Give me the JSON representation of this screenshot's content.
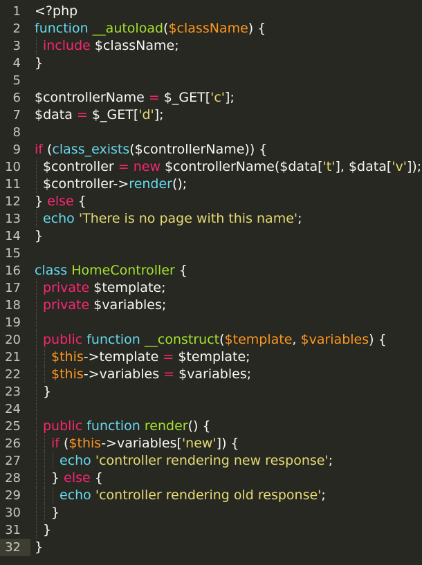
{
  "editor": {
    "theme_colors": {
      "background": "#272822",
      "plain": "#f8f8f2",
      "keyword": "#f92672",
      "storage": "#66d9ef",
      "function": "#a6e22e",
      "parameter": "#fd971f",
      "string": "#e6db74"
    },
    "active_line": 32,
    "lines": [
      {
        "n": "1",
        "indent": 0,
        "tokens": [
          [
            "plain",
            "<?php"
          ]
        ]
      },
      {
        "n": "2",
        "indent": 0,
        "tokens": [
          [
            "storage",
            "function"
          ],
          [
            "plain",
            " "
          ],
          [
            "func",
            "__autoload"
          ],
          [
            "plain",
            "("
          ],
          [
            "param",
            "$className"
          ],
          [
            "plain",
            ") {"
          ]
        ]
      },
      {
        "n": "3",
        "indent": 1,
        "tokens": [
          [
            "kw",
            "include"
          ],
          [
            "plain",
            " $className;"
          ]
        ]
      },
      {
        "n": "4",
        "indent": 0,
        "tokens": [
          [
            "plain",
            "}"
          ]
        ]
      },
      {
        "n": "5",
        "indent": 0,
        "tokens": []
      },
      {
        "n": "6",
        "indent": 0,
        "tokens": [
          [
            "plain",
            "$controllerName "
          ],
          [
            "kw",
            "="
          ],
          [
            "plain",
            " $_GET["
          ],
          [
            "string",
            "'c'"
          ],
          [
            "plain",
            "];"
          ]
        ]
      },
      {
        "n": "7",
        "indent": 0,
        "tokens": [
          [
            "plain",
            "$data "
          ],
          [
            "kw",
            "="
          ],
          [
            "plain",
            " $_GET["
          ],
          [
            "string",
            "'d'"
          ],
          [
            "plain",
            "];"
          ]
        ]
      },
      {
        "n": "8",
        "indent": 0,
        "tokens": []
      },
      {
        "n": "9",
        "indent": 0,
        "tokens": [
          [
            "kw",
            "if"
          ],
          [
            "plain",
            " ("
          ],
          [
            "builtin",
            "class_exists"
          ],
          [
            "plain",
            "($controllerName)) {"
          ]
        ]
      },
      {
        "n": "10",
        "indent": 1,
        "tokens": [
          [
            "plain",
            "$controller "
          ],
          [
            "kw",
            "="
          ],
          [
            "plain",
            " "
          ],
          [
            "kw",
            "new"
          ],
          [
            "plain",
            " $controllerName($data["
          ],
          [
            "string",
            "'t'"
          ],
          [
            "plain",
            "], $data["
          ],
          [
            "string",
            "'v'"
          ],
          [
            "plain",
            "]);"
          ]
        ]
      },
      {
        "n": "11",
        "indent": 1,
        "tokens": [
          [
            "plain",
            "$controller->"
          ],
          [
            "builtin",
            "render"
          ],
          [
            "plain",
            "();"
          ]
        ]
      },
      {
        "n": "12",
        "indent": 0,
        "tokens": [
          [
            "plain",
            "} "
          ],
          [
            "kw",
            "else"
          ],
          [
            "plain",
            " {"
          ]
        ]
      },
      {
        "n": "13",
        "indent": 1,
        "tokens": [
          [
            "builtin",
            "echo"
          ],
          [
            "plain",
            " "
          ],
          [
            "string",
            "'There is no page with this name'"
          ],
          [
            "plain",
            ";"
          ]
        ]
      },
      {
        "n": "14",
        "indent": 0,
        "tokens": [
          [
            "plain",
            "}"
          ]
        ]
      },
      {
        "n": "15",
        "indent": 0,
        "tokens": []
      },
      {
        "n": "16",
        "indent": 0,
        "tokens": [
          [
            "storage",
            "class"
          ],
          [
            "plain",
            " "
          ],
          [
            "func",
            "HomeController"
          ],
          [
            "plain",
            " {"
          ]
        ]
      },
      {
        "n": "17",
        "indent": 1,
        "tokens": [
          [
            "kw",
            "private"
          ],
          [
            "plain",
            " $template;"
          ]
        ]
      },
      {
        "n": "18",
        "indent": 1,
        "tokens": [
          [
            "kw",
            "private"
          ],
          [
            "plain",
            " $variables;"
          ]
        ]
      },
      {
        "n": "19",
        "indent": 1,
        "tokens": []
      },
      {
        "n": "20",
        "indent": 1,
        "tokens": [
          [
            "kw",
            "public"
          ],
          [
            "plain",
            " "
          ],
          [
            "storage",
            "function"
          ],
          [
            "plain",
            " "
          ],
          [
            "func",
            "__construct"
          ],
          [
            "plain",
            "("
          ],
          [
            "param",
            "$template"
          ],
          [
            "plain",
            ", "
          ],
          [
            "param",
            "$variables"
          ],
          [
            "plain",
            ") {"
          ]
        ]
      },
      {
        "n": "21",
        "indent": 2,
        "tokens": [
          [
            "param",
            "$this"
          ],
          [
            "plain",
            "->template "
          ],
          [
            "kw",
            "="
          ],
          [
            "plain",
            " $template;"
          ]
        ]
      },
      {
        "n": "22",
        "indent": 2,
        "tokens": [
          [
            "param",
            "$this"
          ],
          [
            "plain",
            "->variables "
          ],
          [
            "kw",
            "="
          ],
          [
            "plain",
            " $variables;"
          ]
        ]
      },
      {
        "n": "23",
        "indent": 1,
        "tokens": [
          [
            "plain",
            "}"
          ]
        ]
      },
      {
        "n": "24",
        "indent": 1,
        "tokens": []
      },
      {
        "n": "25",
        "indent": 1,
        "tokens": [
          [
            "kw",
            "public"
          ],
          [
            "plain",
            " "
          ],
          [
            "storage",
            "function"
          ],
          [
            "plain",
            " "
          ],
          [
            "func",
            "render"
          ],
          [
            "plain",
            "() {"
          ]
        ]
      },
      {
        "n": "26",
        "indent": 2,
        "tokens": [
          [
            "kw",
            "if"
          ],
          [
            "plain",
            " ("
          ],
          [
            "param",
            "$this"
          ],
          [
            "plain",
            "->variables["
          ],
          [
            "string",
            "'new'"
          ],
          [
            "plain",
            "]) {"
          ]
        ]
      },
      {
        "n": "27",
        "indent": 3,
        "tokens": [
          [
            "builtin",
            "echo"
          ],
          [
            "plain",
            " "
          ],
          [
            "string",
            "'controller rendering new response'"
          ],
          [
            "plain",
            ";"
          ]
        ]
      },
      {
        "n": "28",
        "indent": 2,
        "tokens": [
          [
            "plain",
            "} "
          ],
          [
            "kw",
            "else"
          ],
          [
            "plain",
            " {"
          ]
        ]
      },
      {
        "n": "29",
        "indent": 3,
        "tokens": [
          [
            "builtin",
            "echo"
          ],
          [
            "plain",
            " "
          ],
          [
            "string",
            "'controller rendering old response'"
          ],
          [
            "plain",
            ";"
          ]
        ]
      },
      {
        "n": "30",
        "indent": 2,
        "tokens": [
          [
            "plain",
            "}"
          ]
        ]
      },
      {
        "n": "31",
        "indent": 1,
        "tokens": [
          [
            "plain",
            "}"
          ]
        ]
      },
      {
        "n": "32",
        "indent": 0,
        "tokens": [
          [
            "plain",
            "}"
          ]
        ]
      }
    ]
  }
}
